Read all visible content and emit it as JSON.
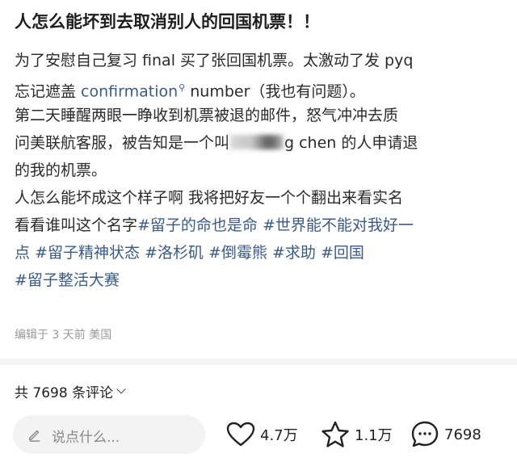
{
  "post": {
    "title": "人怎么能坏到去取消别人的回国机票！！",
    "lines": {
      "l1": "为了安慰自己复习 final 买了张回国机票。太激动了发 pyq",
      "l2_a": "忘记遮盖 ",
      "l2_link": "confirmation",
      "l2_b": " number（我也有问题）。",
      "l3": "第二天睡醒两眼一睁收到机票被退的邮件，怒气冲冲去质",
      "l4_a": "问美联航客服，被告知是一个叫",
      "l4_b": "g chen 的人申请退",
      "l5": "的我的机票。",
      "l6": "人怎么能坏成这个样子啊 我将把好友一个个翻出来看实名",
      "l7_a": "看看谁叫这个名字",
      "l7_tag1": "#留子的命也是命",
      "l7_tag2": "#世界能不能对我好一",
      "l8_tag2b": "点",
      "l8_tag3": "#留子精神状态",
      "l8_tag4": "#洛杉矶",
      "l8_tag5": "#倒霉熊",
      "l8_tag6": "#求助",
      "l8_tag7": "#回国",
      "l9_tag8": "#留子整活大赛"
    },
    "meta": "编辑于 3 天前 美国"
  },
  "comments": {
    "header": "共 7698 条评论"
  },
  "bottom_bar": {
    "input_placeholder": "说点什么...",
    "likes": "4.7万",
    "favorites": "1.1万",
    "comments": "7698",
    "icons": [
      "pencil-icon",
      "heart-icon",
      "star-icon",
      "comment-icon"
    ]
  }
}
